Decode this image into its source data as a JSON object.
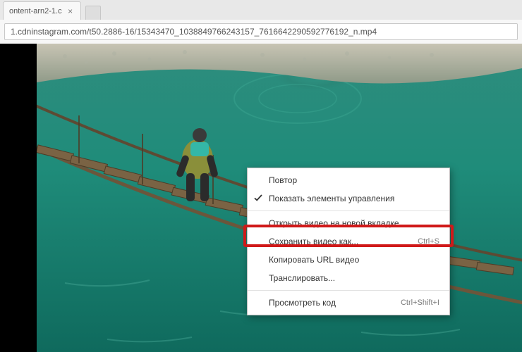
{
  "tab": {
    "title": "ontent-arn2-1.c"
  },
  "addressBar": {
    "url": "1.cdninstagram.com/t50.2886-16/15343470_1038849766243157_7616642290592776192_n.mp4"
  },
  "contextMenu": {
    "items": [
      {
        "label": "Повтор",
        "checked": false,
        "shortcut": ""
      },
      {
        "label": "Показать элементы управления",
        "checked": true,
        "shortcut": ""
      }
    ],
    "group2": [
      {
        "label": "Открыть видео на новой вкладке",
        "shortcut": ""
      },
      {
        "label": "Сохранить видео как...",
        "shortcut": "Ctrl+S",
        "highlighted": true
      },
      {
        "label": "Копировать URL видео",
        "shortcut": ""
      },
      {
        "label": "Транслировать...",
        "shortcut": ""
      }
    ],
    "group3": [
      {
        "label": "Просмотреть код",
        "shortcut": "Ctrl+Shift+I"
      }
    ]
  }
}
